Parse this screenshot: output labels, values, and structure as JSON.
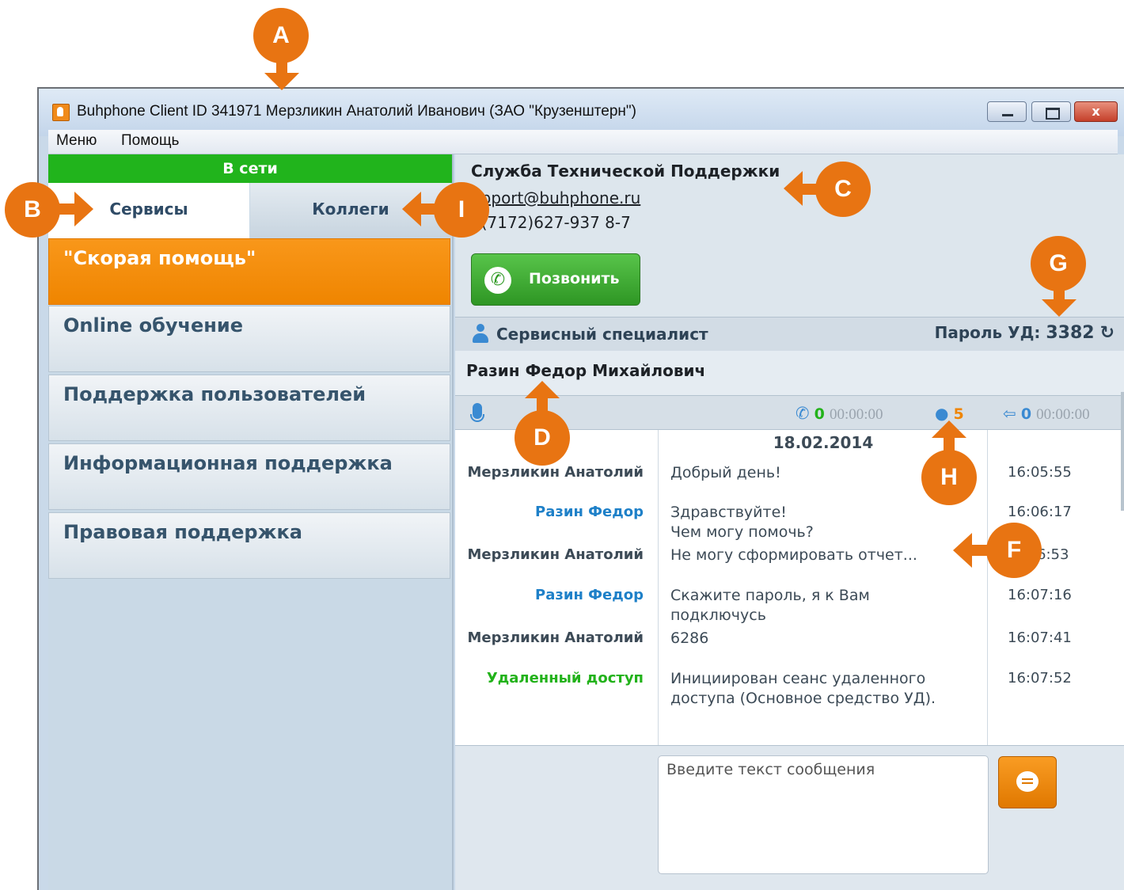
{
  "window": {
    "title": "Buhphone Client ID 341971 Мерзликин Анатолий Иванович (ЗАО \"Крузенштерн\")",
    "close_glyph": "x"
  },
  "menu": {
    "items": [
      "Меню",
      "Помощь"
    ]
  },
  "status": {
    "label": "В сети",
    "color": "#21b41c"
  },
  "tabs": {
    "services": "Сервисы",
    "colleagues": "Коллеги"
  },
  "services": [
    "\"Скорая помощь\"",
    "Online обучение",
    "Поддержка пользователей",
    "Информационная поддержка",
    "Правовая поддержка"
  ],
  "contact": {
    "name": "Служба Технической Поддержки",
    "email": "upport@buhphone.ru",
    "phone": "7(7172)627-937 8-7",
    "call_label": "Позвонить"
  },
  "specialist": {
    "section_title": "Сервисный специалист",
    "password_label": "Пароль УД:",
    "password_value": "3382",
    "name": "Разин Федор Михайлович"
  },
  "stats": {
    "calls_count": "0",
    "calls_time": "00:00:00",
    "messages_count": "5",
    "remote_count": "0",
    "remote_time": "00:00:00"
  },
  "chat": {
    "date": "18.02.2014",
    "messages": [
      {
        "author": "Мерзликин Анатолий",
        "text": "Добрый день!",
        "time": "16:05:55"
      },
      {
        "author": "Разин Федор",
        "text": "Здравствуйте!\nЧем могу помочь?",
        "time": "16:06:17"
      },
      {
        "author": "Мерзликин Анатолий",
        "text": "Не могу сформировать отчет...",
        "time": "6:53"
      },
      {
        "author": "Разин Федор",
        "text": "Скажите пароль, я к Вам подключусь",
        "time": "16:07:16"
      },
      {
        "author": "Мерзликин Анатолий",
        "text": "6286",
        "time": "16:07:41"
      },
      {
        "author": "Удаленный доступ",
        "text": "Инициирован сеанс удаленного доступа (Основное средство УД).",
        "time": "16:07:52"
      }
    ]
  },
  "compose": {
    "placeholder": "Введите текст сообщения"
  },
  "markers": {
    "a": "A",
    "b": "B",
    "c": "C",
    "d": "D",
    "f": "F",
    "g": "G",
    "h": "H",
    "i": "I"
  },
  "colors": {
    "accent": "#e87412",
    "client": "#3c4a56",
    "agent": "#1e80c8",
    "remote": "#22b21a"
  }
}
